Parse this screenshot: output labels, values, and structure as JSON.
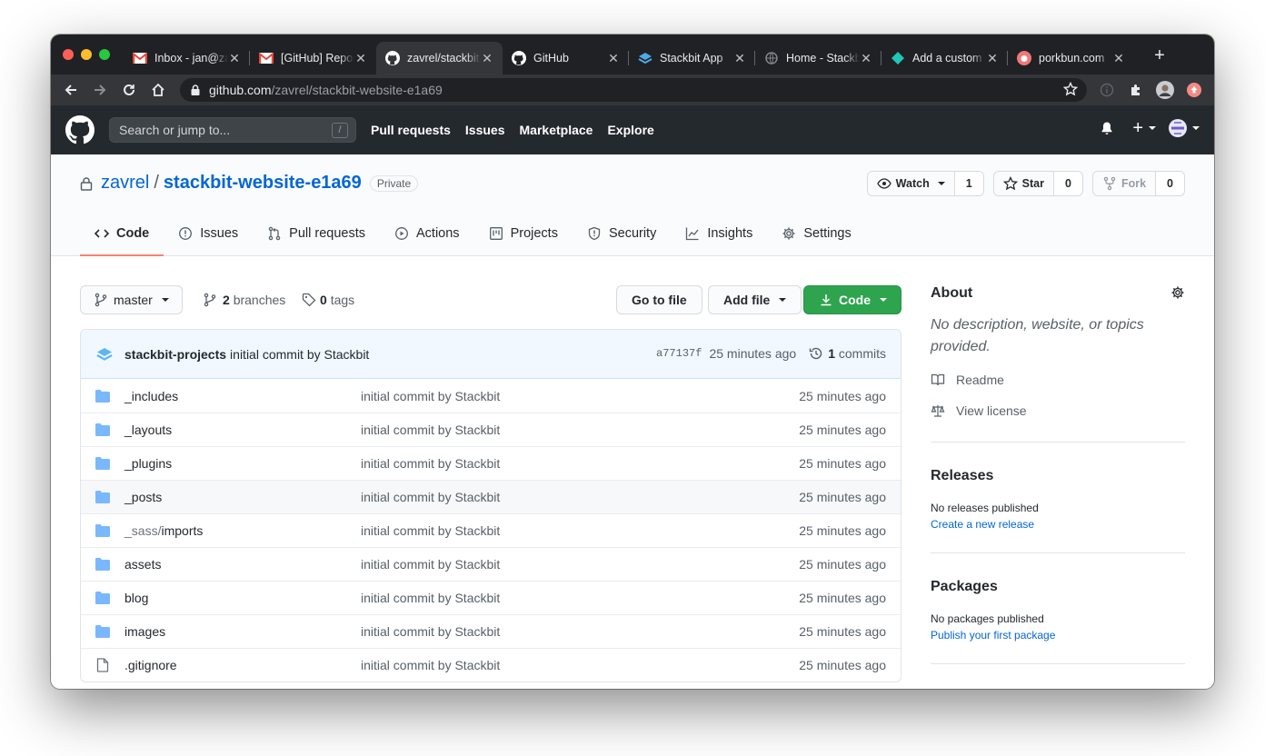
{
  "browser": {
    "tabs": [
      {
        "title": "Inbox - jan@zavrel.net",
        "favicon": "gmail-icon",
        "active": false
      },
      {
        "title": "[GitHub] Repository",
        "favicon": "gmail-icon",
        "active": false
      },
      {
        "title": "zavrel/stackbit-website",
        "favicon": "github-icon",
        "active": true
      },
      {
        "title": "GitHub",
        "favicon": "github-icon",
        "active": false
      },
      {
        "title": "Stackbit App",
        "favicon": "stackbit-icon",
        "active": false
      },
      {
        "title": "Home - Stackbit",
        "favicon": "globe-icon",
        "active": false
      },
      {
        "title": "Add a custom domain",
        "favicon": "netlify-icon",
        "active": false
      },
      {
        "title": "porkbun.com",
        "favicon": "porkbun-icon",
        "active": false
      }
    ],
    "url_host": "github.com",
    "url_path": "/zavrel/stackbit-website-e1a69"
  },
  "gh_header": {
    "search_placeholder": "Search or jump to...",
    "search_key": "/",
    "nav": [
      "Pull requests",
      "Issues",
      "Marketplace",
      "Explore"
    ]
  },
  "repo": {
    "owner": "zavrel",
    "separator": "/",
    "name": "stackbit-website-e1a69",
    "visibility": "Private",
    "watch_label": "Watch",
    "watch_count": "1",
    "star_label": "Star",
    "star_count": "0",
    "fork_label": "Fork",
    "fork_count": "0"
  },
  "reponav": [
    "Code",
    "Issues",
    "Pull requests",
    "Actions",
    "Projects",
    "Security",
    "Insights",
    "Settings"
  ],
  "toolbar": {
    "branch": "master",
    "branches_count": "2",
    "branches_label": "branches",
    "tags_count": "0",
    "tags_label": "tags",
    "go_to_file": "Go to file",
    "add_file": "Add file",
    "code": "Code"
  },
  "latest_commit": {
    "author": "stackbit-projects",
    "message": "initial commit by Stackbit",
    "sha": "a77137f",
    "age": "25 minutes ago",
    "commits_count": "1",
    "commits_label": "commits"
  },
  "files": [
    {
      "pre": "",
      "name": "_includes",
      "type": "dir",
      "message": "initial commit by Stackbit",
      "age": "25 minutes ago"
    },
    {
      "pre": "",
      "name": "_layouts",
      "type": "dir",
      "message": "initial commit by Stackbit",
      "age": "25 minutes ago"
    },
    {
      "pre": "",
      "name": "_plugins",
      "type": "dir",
      "message": "initial commit by Stackbit",
      "age": "25 minutes ago"
    },
    {
      "pre": "",
      "name": "_posts",
      "type": "dir",
      "message": "initial commit by Stackbit",
      "age": "25 minutes ago"
    },
    {
      "pre": "_sass/",
      "name": "imports",
      "type": "dir",
      "message": "initial commit by Stackbit",
      "age": "25 minutes ago"
    },
    {
      "pre": "",
      "name": "assets",
      "type": "dir",
      "message": "initial commit by Stackbit",
      "age": "25 minutes ago"
    },
    {
      "pre": "",
      "name": "blog",
      "type": "dir",
      "message": "initial commit by Stackbit",
      "age": "25 minutes ago"
    },
    {
      "pre": "",
      "name": "images",
      "type": "dir",
      "message": "initial commit by Stackbit",
      "age": "25 minutes ago"
    },
    {
      "pre": "",
      "name": ".gitignore",
      "type": "file",
      "message": "initial commit by Stackbit",
      "age": "25 minutes ago"
    }
  ],
  "sidebar": {
    "about_title": "About",
    "about_desc": "No description, website, or topics provided.",
    "readme": "Readme",
    "license": "View license",
    "releases_title": "Releases",
    "releases_none": "No releases published",
    "releases_link": "Create a new release",
    "packages_title": "Packages",
    "packages_none": "No packages published",
    "packages_link": "Publish your first package"
  },
  "colors": {
    "header_bg": "#24292e",
    "link": "#0366d6",
    "primary_button": "#2ea44f",
    "selected_tab_underline": "#f9826c",
    "folder": "#79b8ff"
  }
}
